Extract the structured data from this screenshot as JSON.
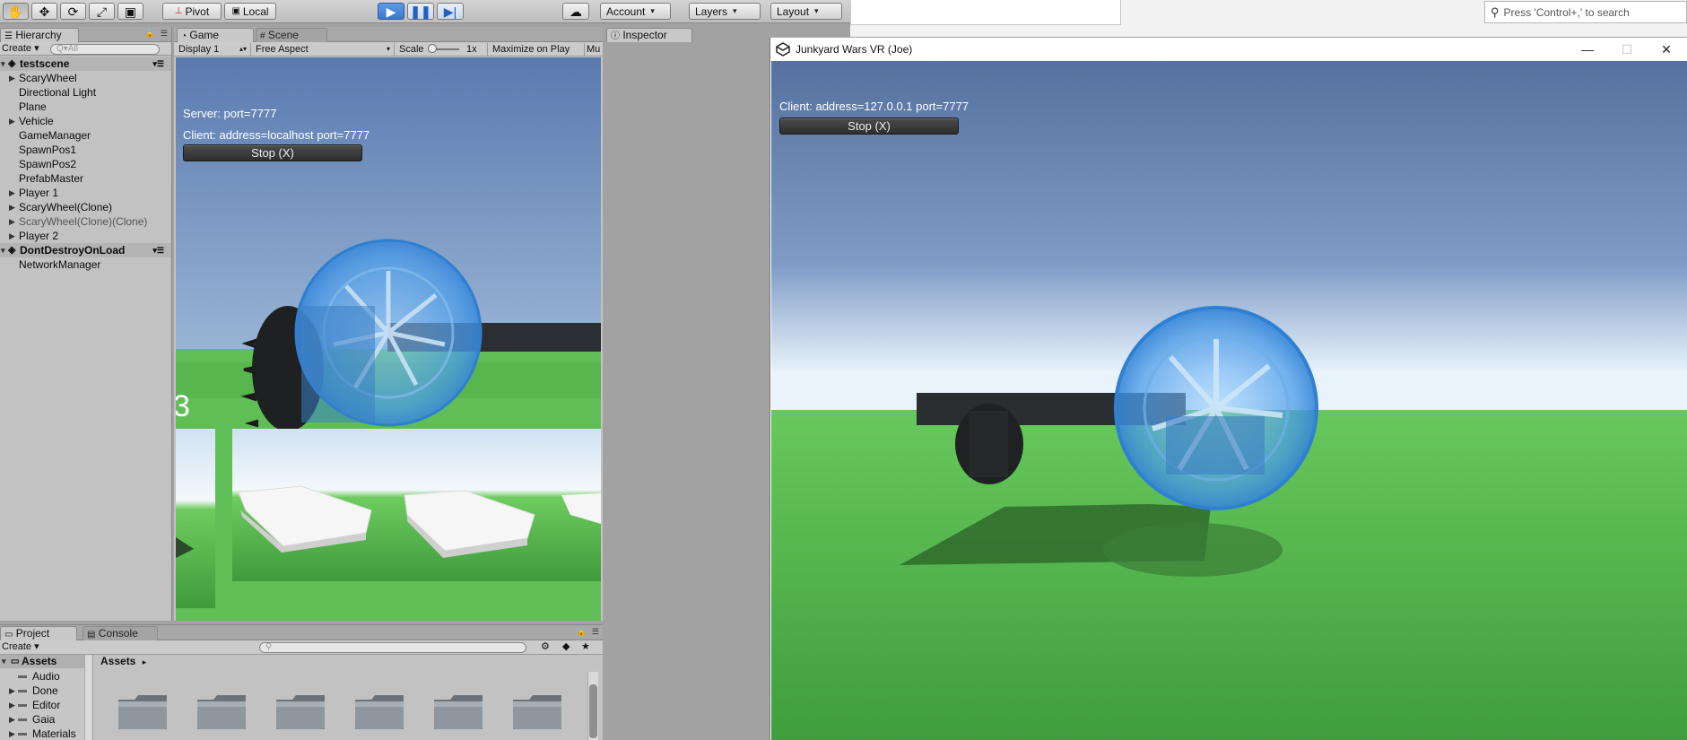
{
  "toolbar": {
    "pivot_label": "Pivot",
    "local_label": "Local",
    "account_label": "Account",
    "layers_label": "Layers",
    "layout_label": "Layout"
  },
  "search": {
    "placeholder": "Press 'Control+,' to search"
  },
  "hierarchy": {
    "tab_label": "Hierarchy",
    "create_label": "Create",
    "search_placeholder": "Q▾All",
    "scenes": [
      {
        "name": "testscene",
        "items": [
          {
            "label": "ScaryWheel",
            "expandable": true,
            "dim": false
          },
          {
            "label": "Directional Light",
            "expandable": false,
            "dim": false
          },
          {
            "label": "Plane",
            "expandable": false,
            "dim": false
          },
          {
            "label": "Vehicle",
            "expandable": true,
            "dim": false
          },
          {
            "label": "GameManager",
            "expandable": false,
            "dim": false
          },
          {
            "label": "SpawnPos1",
            "expandable": false,
            "dim": false
          },
          {
            "label": "SpawnPos2",
            "expandable": false,
            "dim": false
          },
          {
            "label": "PrefabMaster",
            "expandable": false,
            "dim": false
          },
          {
            "label": "Player 1",
            "expandable": true,
            "dim": false
          },
          {
            "label": "ScaryWheel(Clone)",
            "expandable": true,
            "dim": false
          },
          {
            "label": "ScaryWheel(Clone)(Clone)",
            "expandable": true,
            "dim": true
          },
          {
            "label": "Player 2",
            "expandable": true,
            "dim": false
          }
        ]
      },
      {
        "name": "DontDestroyOnLoad",
        "items": [
          {
            "label": "NetworkManager",
            "expandable": false,
            "dim": false
          }
        ]
      }
    ]
  },
  "game": {
    "tab_game": "Game",
    "tab_scene": "Scene",
    "display": "Display 1",
    "aspect": "Free Aspect",
    "scale_label": "Scale",
    "scale_value": "1x",
    "maximize_label": "Maximize on Play",
    "mute_label": "Mu",
    "server_text": "Server: port=7777",
    "client_text": "Client: address=localhost port=7777",
    "stop_label": "Stop (X)",
    "countdown": "3"
  },
  "inspector": {
    "tab_label": "Inspector"
  },
  "project": {
    "tab_project": "Project",
    "tab_console": "Console",
    "create_label": "Create",
    "tree_root": "Assets",
    "tree_items": [
      "Audio",
      "Done",
      "Editor",
      "Gaia",
      "Materials"
    ],
    "breadcrumb": "Assets",
    "folder_count": 6
  },
  "player_window": {
    "title": "Junkyard Wars VR (Joe)",
    "client_text": "Client: address=127.0.0.1 port=7777",
    "stop_label": "Stop (X)"
  },
  "colors": {
    "sky_top": "#5a7ab0",
    "sky_horizon": "#e8f2fa",
    "ground": "#5fbe56",
    "wheel_glow": "#4a9be8",
    "play_blue": "#3a78cf"
  }
}
